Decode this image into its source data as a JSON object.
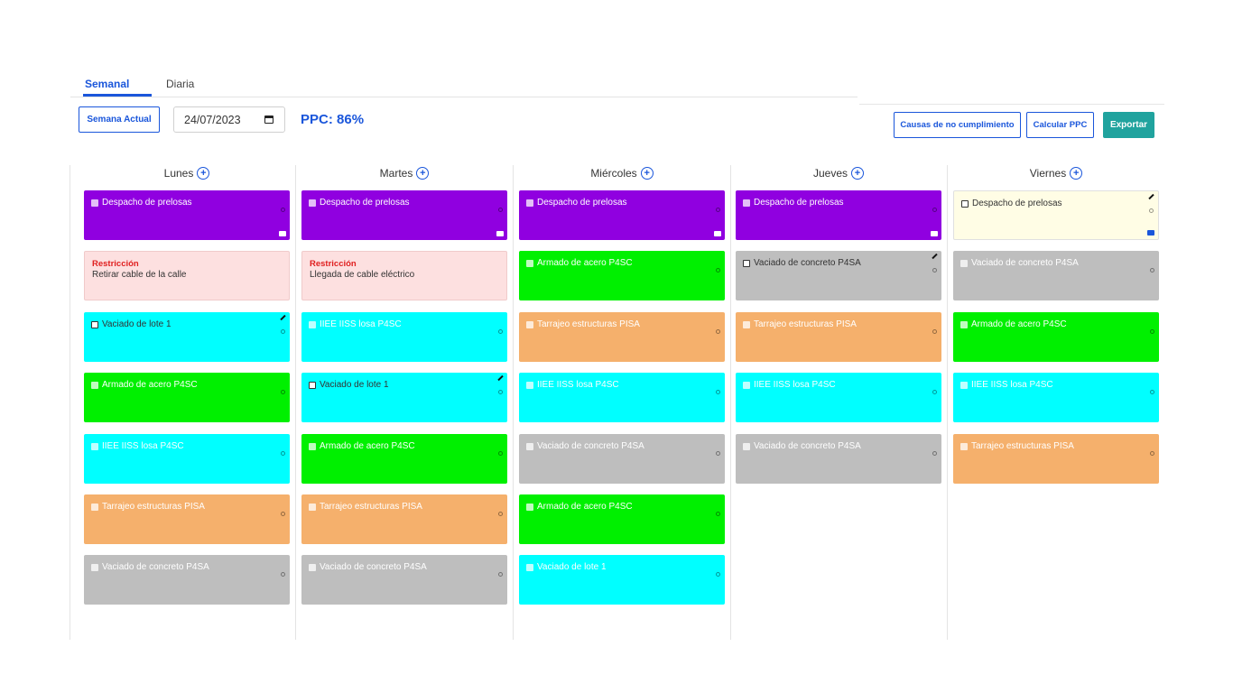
{
  "tabs": [
    {
      "label": "Semanal"
    },
    {
      "label": "Diaria"
    }
  ],
  "toolbar": {
    "current_week_label": "Semana Actual",
    "date_value": "24/07/2023",
    "ppc_label": "PPC: 86%",
    "causes_label": "Causas de no cumplimiento",
    "calc_label": "Calcular PPC",
    "export_label": "Exportar"
  },
  "colors": {
    "accent": "#1a56db",
    "export": "#20a39e",
    "purple": "#9000e0",
    "green": "#00f000",
    "cyan": "#00ffff",
    "orange": "#f5b06c",
    "gray": "#bebebe",
    "restriction": "#fde0e0",
    "restriction_label": "#e02020"
  },
  "days": [
    {
      "name": "Lunes",
      "cards": [
        {
          "title": "Despacho de prelosas",
          "color": "purple",
          "truck": true
        },
        {
          "type": "restriction",
          "label": "Restricción",
          "text": "Retirar cable de la calle"
        },
        {
          "title": "Vaciado de lote 1",
          "color": "cyan",
          "checkbox": true,
          "edit": true,
          "dark": true
        },
        {
          "title": "Armado de acero P4SC",
          "color": "green"
        },
        {
          "title": "IIEE IISS losa P4SC",
          "color": "cyan"
        },
        {
          "title": "Tarrajeo estructuras PISA",
          "color": "orange"
        },
        {
          "title": "Vaciado de concreto P4SA",
          "color": "gray"
        }
      ]
    },
    {
      "name": "Martes",
      "cards": [
        {
          "title": "Despacho de prelosas",
          "color": "purple",
          "truck": true
        },
        {
          "type": "restriction",
          "label": "Restricción",
          "text": "Llegada de cable eléctrico"
        },
        {
          "title": "IIEE IISS losa P4SC",
          "color": "cyan"
        },
        {
          "title": "Vaciado de lote 1",
          "color": "cyan",
          "checkbox": true,
          "edit": true,
          "dark": true
        },
        {
          "title": "Armado de acero P4SC",
          "color": "green"
        },
        {
          "title": "Tarrajeo estructuras PISA",
          "color": "orange"
        },
        {
          "title": "Vaciado de concreto P4SA",
          "color": "gray"
        }
      ]
    },
    {
      "name": "Miércoles",
      "cards": [
        {
          "title": "Despacho de prelosas",
          "color": "purple",
          "truck": true
        },
        {
          "title": "Armado de acero P4SC",
          "color": "green"
        },
        {
          "title": "Tarrajeo estructuras PISA",
          "color": "orange"
        },
        {
          "title": "IIEE IISS losa P4SC",
          "color": "cyan"
        },
        {
          "title": "Vaciado de concreto P4SA",
          "color": "gray"
        },
        {
          "title": "Armado de acero P4SC",
          "color": "green"
        },
        {
          "title": "Vaciado de lote 1",
          "color": "cyan"
        }
      ]
    },
    {
      "name": "Jueves",
      "cards": [
        {
          "title": "Despacho de prelosas",
          "color": "purple",
          "truck": true
        },
        {
          "title": "Vaciado de concreto P4SA",
          "color": "gray",
          "checkbox": true,
          "edit": true,
          "dark": true
        },
        {
          "title": "Tarrajeo estructuras PISA",
          "color": "orange"
        },
        {
          "title": "IIEE IISS losa P4SC",
          "color": "cyan"
        },
        {
          "title": "Vaciado de concreto P4SA",
          "color": "gray"
        }
      ]
    },
    {
      "name": "Viernes",
      "cards": [
        {
          "title": "Despacho de prelosas",
          "color": "cream",
          "checkbox": true,
          "edit": true,
          "dark": true,
          "truck": true,
          "truck_blue": true
        },
        {
          "title": "Vaciado de concreto P4SA",
          "color": "gray"
        },
        {
          "title": "Armado de acero P4SC",
          "color": "green"
        },
        {
          "title": "IIEE IISS losa P4SC",
          "color": "cyan"
        },
        {
          "title": "Tarrajeo estructuras PISA",
          "color": "orange"
        }
      ]
    }
  ]
}
